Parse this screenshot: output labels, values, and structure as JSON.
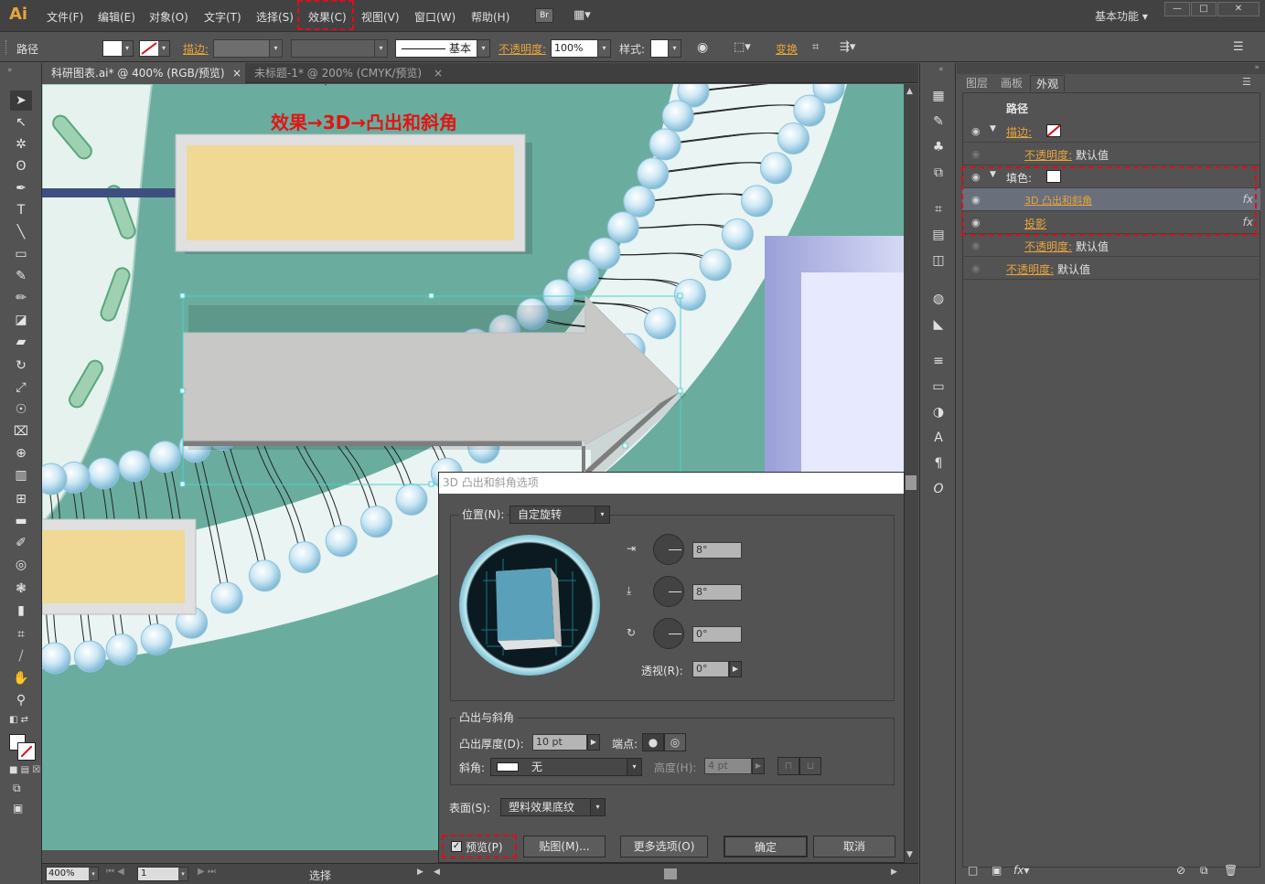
{
  "app": {
    "logo": "Ai",
    "workspace": "基本功能",
    "br": "Br"
  },
  "menu": [
    "文件(F)",
    "编辑(E)",
    "对象(O)",
    "文字(T)",
    "选择(S)",
    "效果(C)",
    "视图(V)",
    "窗口(W)",
    "帮助(H)"
  ],
  "window_controls": {
    "minimize": "—",
    "maximize": "□",
    "close": "✕"
  },
  "control_bar": {
    "object_type": "路径",
    "stroke_label": "描边:",
    "stroke_profile": "基本",
    "opacity_label": "不透明度:",
    "opacity_value": "100%",
    "style_label": "样式:",
    "transform_label": "变换"
  },
  "tabs": [
    {
      "label": "科研图表.ai* @ 400% (RGB/预览)",
      "close": "×"
    },
    {
      "label": "未标题-1* @ 200% (CMYK/预览)",
      "close": "×"
    }
  ],
  "annotation": "效果→3D→凸出和斜角",
  "panel": {
    "tabs": [
      "图层",
      "画板",
      "外观"
    ],
    "heading": "路径",
    "rows": [
      {
        "label": "描边:",
        "value": ""
      },
      {
        "label": "不透明度:",
        "value": "默认值"
      },
      {
        "label": "填色:",
        "value": ""
      },
      {
        "label": "3D 凸出和斜角",
        "value": "",
        "fx": "fx"
      },
      {
        "label": "投影",
        "value": "",
        "fx": "fx"
      },
      {
        "label": "不透明度:",
        "value": "默认值"
      },
      {
        "label": "不透明度:",
        "value": "默认值"
      }
    ],
    "footer_fx": "fx"
  },
  "dialog": {
    "title": "3D 凸出和斜角选项",
    "position_label": "位置(N):",
    "position_value": "自定旋转",
    "rot_x": "8°",
    "rot_y": "8°",
    "rot_z": "0°",
    "perspective_label": "透视(R):",
    "perspective_value": "0°",
    "extrude_group": "凸出与斜角",
    "depth_label": "凸出厚度(D):",
    "depth_value": "10 pt",
    "cap_label": "端点:",
    "bevel_label": "斜角:",
    "bevel_value": "无",
    "height_label": "高度(H):",
    "height_value": "4 pt",
    "surface_label": "表面(S):",
    "surface_value": "塑料效果底纹",
    "preview_label": "预览(P)",
    "map_button": "贴图(M)...",
    "more_button": "更多选项(O)",
    "ok_button": "确定",
    "cancel_button": "取消"
  },
  "status": {
    "zoom": "400%",
    "page": "1",
    "tool": "选择"
  },
  "colors": {
    "accent_orange": "#e8a43c",
    "highlight_red": "#d6101c",
    "canvas_teal": "#6aad9f"
  }
}
